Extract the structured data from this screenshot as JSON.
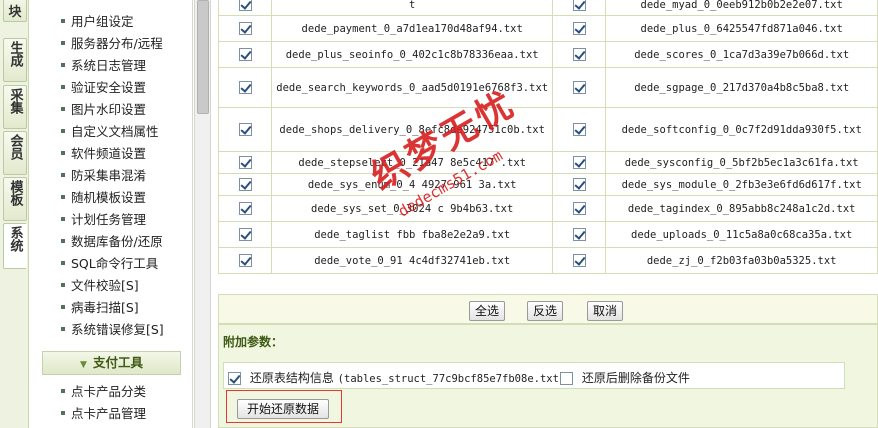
{
  "vtabs": [
    {
      "label": "块",
      "active": false
    },
    {
      "label": "生成",
      "active": false
    },
    {
      "label": "采集",
      "active": false
    },
    {
      "label": "会员",
      "active": false
    },
    {
      "label": "模板",
      "active": false
    },
    {
      "label": "系统",
      "active": true
    }
  ],
  "menu": {
    "items": [
      "用户组设定",
      "服务器分布/远程",
      "系统日志管理",
      "验证安全设置",
      "图片水印设置",
      "自定义文档属性",
      "软件频道设置",
      "防采集串混淆",
      "随机模板设置",
      "计划任务管理",
      "数据库备份/还原",
      "SQL命令行工具",
      "文件校验[S]",
      "病毒扫描[S]",
      "系统错误修复[S]"
    ],
    "section": "支付工具",
    "section_items": [
      "点卡产品分类",
      "点卡产品管理"
    ]
  },
  "files": {
    "rows": [
      {
        "left": {
          "name": "t",
          "checked": true
        },
        "right": {
          "name": "dede_myad_0_0eeb912b0b2e2e07.txt",
          "checked": true
        }
      },
      {
        "left": {
          "name": "dede_payment_0_a7d1ea170d48af94.txt",
          "checked": true
        },
        "right": {
          "name": "dede_plus_0_6425547fd871a046.txt",
          "checked": true
        }
      },
      {
        "left": {
          "name": "dede_plus_seoinfo_0_402c1c8b78336eaa.txt",
          "checked": true
        },
        "right": {
          "name": "dede_scores_0_1ca7d3a39e7b066d.txt",
          "checked": true
        }
      },
      {
        "left": {
          "name": "dede_search_keywords_0_aad5d0191e6768f3.txt",
          "checked": true
        },
        "right": {
          "name": "dede_sgpage_0_217d370a4b8c5ba8.txt",
          "checked": true
        }
      },
      {
        "left": {
          "name": "dede_shops_delivery_0_8efc8de924751c0b.txt",
          "checked": true
        },
        "right": {
          "name": "dede_softconfig_0_0c7f2d91dda930f5.txt",
          "checked": true
        }
      },
      {
        "left": {
          "name": "dede_stepselect_0_21a47  8e5c417  .txt",
          "checked": true
        },
        "right": {
          "name": "dede_sysconfig_0_5bf2b5ec1a3c61fa.txt",
          "checked": true
        }
      },
      {
        "left": {
          "name": "dede_sys_enum_0_4  4927  961  3a.txt",
          "checked": true
        },
        "right": {
          "name": "dede_sys_module_0_2fb3e3e6fd6d617f.txt",
          "checked": true
        }
      },
      {
        "left": {
          "name": "dede_sys_set_0_3024  c  9b4b63.txt",
          "checked": true
        },
        "right": {
          "name": "dede_tagindex_0_895abb8c248a1c2d.txt",
          "checked": true
        }
      },
      {
        "left": {
          "name": "dede_taglist  fbb  fba8e2e2a9.txt",
          "checked": true
        },
        "right": {
          "name": "dede_uploads_0_11c5a8a0c68ca35a.txt",
          "checked": true
        }
      },
      {
        "left": {
          "name": "dede_vote_0_91  4c4df32741eb.txt",
          "checked": true
        },
        "right": {
          "name": "dede_zj_0_f2b03fa03b0a5325.txt",
          "checked": true
        }
      }
    ]
  },
  "buttons": {
    "select_all": "全选",
    "invert": "反选",
    "cancel": "取消"
  },
  "additional": {
    "title": "附加参数：",
    "restore_struct_label": "还原表结构信息",
    "restore_struct_file": "(tables_struct_77c9bcf85e7fb08e.txt)",
    "restore_struct_checked": true,
    "delete_after_label": "还原后删除备份文件",
    "delete_after_checked": false,
    "start_button": "开始还原数据"
  },
  "watermark": {
    "text": "织梦无忧",
    "url": "dedecms51.com"
  },
  "colors": {
    "accent_green": "#3f5a15",
    "highlight_red": "#e23a2e",
    "panel_bg": "#f1f6e1"
  }
}
